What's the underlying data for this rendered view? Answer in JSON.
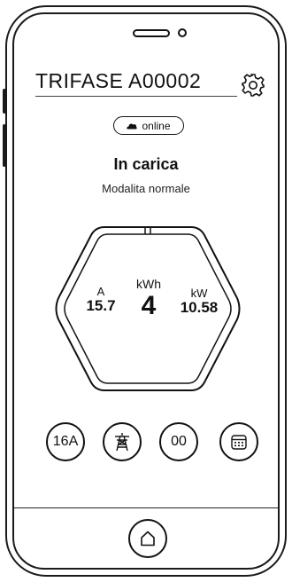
{
  "device": {
    "title": "TRIFASE  A00002",
    "status_pill": "online",
    "status_icon": "cloud-icon"
  },
  "charging": {
    "state": "In carica",
    "mode": "Modalita normale"
  },
  "readings": {
    "current_unit": "A",
    "current_value": "15.7",
    "energy_unit": "kWh",
    "energy_value": "4",
    "power_unit": "kW",
    "power_value": "10.58"
  },
  "actions": {
    "amperage_label": "16A",
    "pause_label": "00",
    "grid_icon": "pylon-icon",
    "calendar_icon": "calendar-icon"
  },
  "nav": {
    "home_icon": "home-icon"
  }
}
